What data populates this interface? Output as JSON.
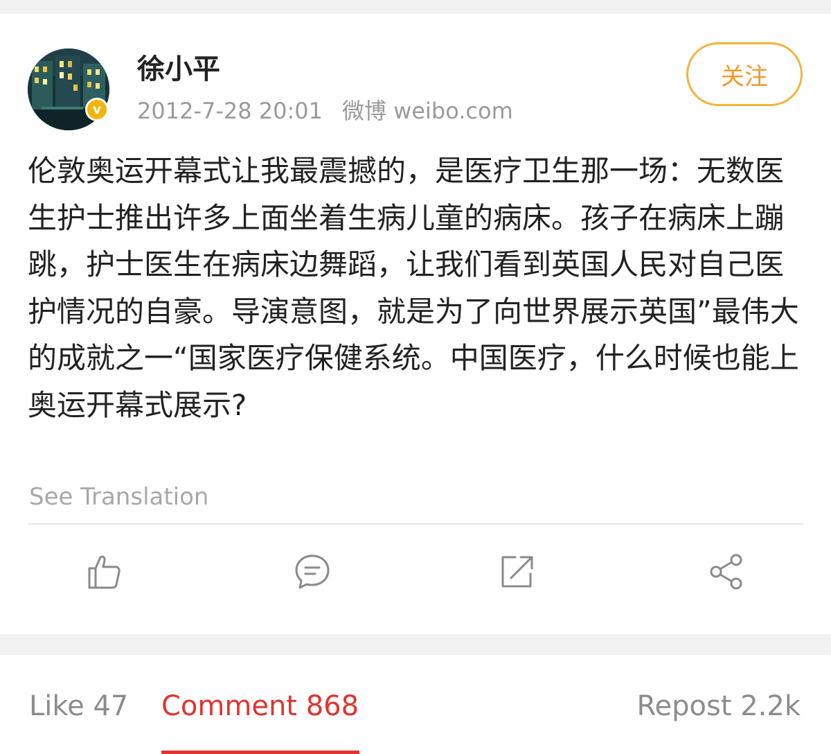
{
  "post": {
    "author": "徐小平",
    "verified_badge": "v",
    "timestamp": "2012-7-28 20:01",
    "source": "微博 weibo.com",
    "follow_label": "关注",
    "text": "伦敦奥运开幕式让我最震撼的，是医疗卫生那一场：无数医生护士推出许多上面坐着生病儿童的病床。孩子在病床上蹦跳，护士医生在病床边舞蹈，让我们看到英国人民对自己医护情况的自豪。导演意图，就是为了向世界展示英国”最伟大的成就之一“国家医疗保健系统。中国医疗，什么时候也能上奥运开幕式展示?",
    "see_translation": "See Translation"
  },
  "actions": [
    {
      "name": "like-icon"
    },
    {
      "name": "comment-icon"
    },
    {
      "name": "repost-icon"
    },
    {
      "name": "share-icon"
    }
  ],
  "tabs": {
    "like": "Like 47",
    "comment": "Comment 868",
    "repost": "Repost 2.2k",
    "active": "comment"
  },
  "colors": {
    "accent": "#e1332f",
    "follow": "#ee9a2a",
    "verified": "#f4b40a",
    "muted_text": "#9a9a9a",
    "body_text": "#222222"
  }
}
